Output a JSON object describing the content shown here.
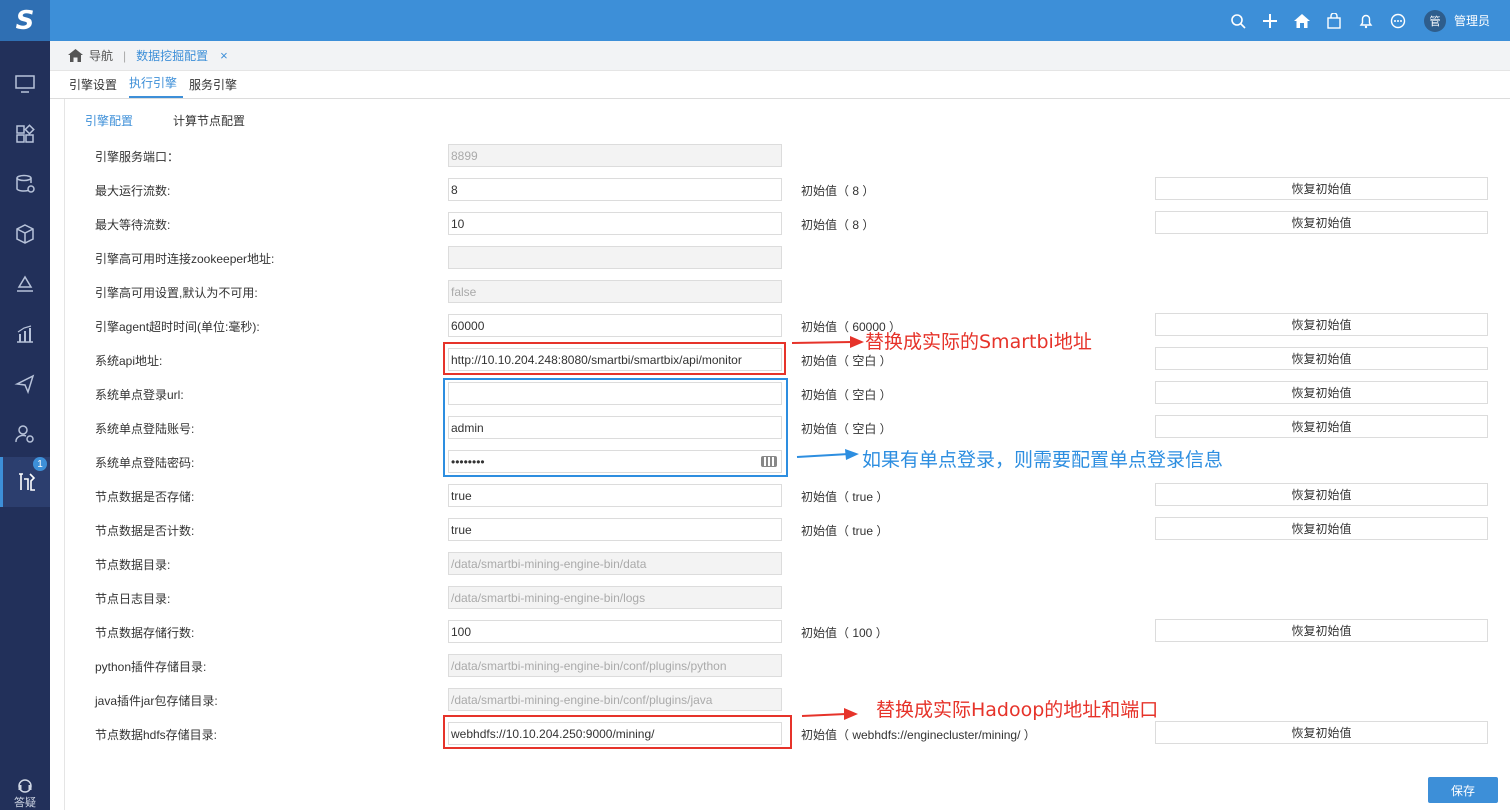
{
  "app": {
    "logo_text": "S",
    "username": "管理员",
    "avatar_text": "管"
  },
  "topbar_icons": [
    "search-icon",
    "plus-icon",
    "home-icon",
    "bag-icon",
    "bell-icon",
    "chat-icon"
  ],
  "sidebar": {
    "items": [
      "monitor-icon",
      "apps-icon",
      "database-icon",
      "cube-icon",
      "layers-icon",
      "chart-icon",
      "send-icon",
      "user-gear-icon",
      "tools-icon"
    ],
    "active_index": 8,
    "badge": "1",
    "help_label": "答疑"
  },
  "breadcrumb": {
    "home": "导航",
    "current": "数据挖掘配置",
    "close": "×"
  },
  "tabs": [
    "引擎设置",
    "执行引擎",
    "服务引擎"
  ],
  "active_tab": 1,
  "subtabs": [
    "引擎配置",
    "计算节点配置"
  ],
  "active_subtab": 0,
  "reset_label": "恢复初始值",
  "save_label": "保存",
  "rows": [
    {
      "label": "引擎服务端口：",
      "value": "8899",
      "disabled": true,
      "init": ""
    },
    {
      "label": "最大运行流数:",
      "value": "8",
      "disabled": false,
      "init": "初始值（ 8 ）"
    },
    {
      "label": "最大等待流数:",
      "value": "10",
      "disabled": false,
      "init": "初始值（ 8 ）"
    },
    {
      "label": "引擎高可用时连接zookeeper地址:",
      "value": "",
      "disabled": true,
      "init": ""
    },
    {
      "label": "引擎高可用设置,默认为不可用:",
      "value": "false",
      "disabled": true,
      "init": ""
    },
    {
      "label": "引擎agent超时时间(单位:毫秒):",
      "value": "60000",
      "disabled": false,
      "init": "初始值（ 60000 ）"
    },
    {
      "label": "系统api地址:",
      "value": "http://10.10.204.248:8080/smartbi/smartbix/api/monitor",
      "disabled": false,
      "init": "初始值（ 空白 ）"
    },
    {
      "label": "系统单点登录url:",
      "value": "",
      "disabled": false,
      "init": "初始值（ 空白 ）"
    },
    {
      "label": "系统单点登陆账号:",
      "value": "admin",
      "disabled": false,
      "init": "初始值（ 空白 ）"
    },
    {
      "label": "系统单点登陆密码:",
      "value": "••••••••",
      "disabled": false,
      "init": ""
    },
    {
      "label": "节点数据是否存储:",
      "value": "true",
      "disabled": false,
      "init": "初始值（ true ）"
    },
    {
      "label": "节点数据是否计数:",
      "value": "true",
      "disabled": false,
      "init": "初始值（ true ）"
    },
    {
      "label": "节点数据目录:",
      "value": "/data/smartbi-mining-engine-bin/data",
      "disabled": true,
      "init": ""
    },
    {
      "label": "节点日志目录:",
      "value": "/data/smartbi-mining-engine-bin/logs",
      "disabled": true,
      "init": ""
    },
    {
      "label": "节点数据存储行数:",
      "value": "100",
      "disabled": false,
      "init": "初始值（ 100 ）"
    },
    {
      "label": "python插件存储目录:",
      "value": "/data/smartbi-mining-engine-bin/conf/plugins/python",
      "disabled": true,
      "init": ""
    },
    {
      "label": "java插件jar包存储目录:",
      "value": "/data/smartbi-mining-engine-bin/conf/plugins/java",
      "disabled": true,
      "init": ""
    },
    {
      "label": "节点数据hdfs存储目录:",
      "value": "webhdfs://10.10.204.250:9000/mining/",
      "disabled": false,
      "init": "初始值（ webhdfs://enginecluster/mining/ ）"
    }
  ],
  "annotations": {
    "smartbi_note": "替换成实际的Smartbi地址",
    "sso_note": "如果有单点登录，则需要配置单点登录信息",
    "hadoop_note": "替换成实际Hadoop的地址和端口"
  },
  "colors": {
    "accent": "#3d8fd8",
    "sidebar": "#22305a",
    "annotation_red": "#e6332a",
    "annotation_blue": "#2d8ee0"
  }
}
